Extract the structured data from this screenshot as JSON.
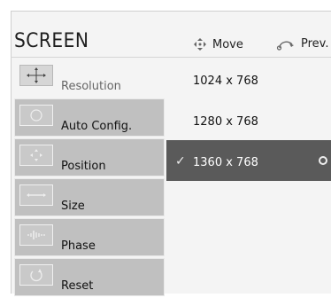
{
  "header": {
    "title": "SCREEN",
    "move_label": "Move",
    "prev_label": "Prev."
  },
  "sidebar": {
    "items": [
      {
        "label": "Resolution",
        "icon": "resolution-icon",
        "active": true
      },
      {
        "label": "Auto Config.",
        "icon": "auto-config-icon",
        "active": false
      },
      {
        "label": "Position",
        "icon": "position-icon",
        "active": false
      },
      {
        "label": "Size",
        "icon": "size-icon",
        "active": false
      },
      {
        "label": "Phase",
        "icon": "phase-icon",
        "active": false
      },
      {
        "label": "Reset",
        "icon": "reset-icon",
        "active": false
      }
    ]
  },
  "options": {
    "items": [
      {
        "label": "1024 x 768",
        "selected": false
      },
      {
        "label": "1280 x 768",
        "selected": false
      },
      {
        "label": "1360 x 768",
        "selected": true
      }
    ],
    "check_glyph": "✓"
  },
  "colors": {
    "selected_bg": "#5a5a5a",
    "menu_item_bg": "#c0c0c0",
    "panel_bg": "#f4f4f4"
  }
}
